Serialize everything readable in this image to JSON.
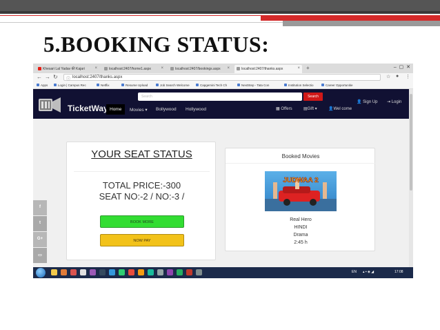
{
  "slide": {
    "title": "5.BOOKING STATUS:"
  },
  "browser": {
    "tabs": [
      {
        "label": "Khesari Lal Yadav की Kajari",
        "icon": "youtube-icon",
        "active": false
      },
      {
        "label": "localhost:2407/home1.aspx",
        "icon": "page-icon",
        "active": false
      },
      {
        "label": "localhost:2407/bookings.aspx",
        "icon": "page-icon",
        "active": false
      },
      {
        "label": "localhost:2407/thanks.aspx",
        "icon": "page-icon",
        "active": true
      }
    ],
    "url": "localhost:2407/thanks.aspx",
    "bookmarks": [
      "Apps",
      "Login | Campus Rec",
      "Netflix",
      "Resume Upload",
      "Job Search Welcome",
      "Capgemini Tech Ch",
      "NextStep - Tata Con",
      "Institution Selectio",
      "Career Opportunitie"
    ]
  },
  "site": {
    "search_placeholder": "Search",
    "search_button": "Search",
    "logo": "TicketWay",
    "nav": [
      "Home",
      "Movies ▾",
      "Bollywood",
      "Hollywood"
    ],
    "signup": "Sign Up",
    "login": "Login",
    "offers": "Offers",
    "gift": "Gift ▾",
    "welcome": "Wel come"
  },
  "seat_status": {
    "title": "YOUR SEAT STATUS",
    "total_price": "TOTAL PRICE:-300",
    "seat_no": "SEAT NO:-2 / NO:-3 /",
    "book_more": "BOOK MORE",
    "now_pay": "NOW PAY"
  },
  "booked_movies": {
    "heading": "Booked Movies",
    "poster_title": "JUDWAA 2",
    "details": [
      "Real Hero",
      "HINDI",
      "Drama",
      "2:45 h"
    ]
  },
  "social": [
    "f",
    "t",
    "G+",
    "▭"
  ],
  "taskbar": {
    "lang": "EN",
    "time": "17:08"
  },
  "colors": {
    "navbar": "#111133",
    "search_button": "#d01818",
    "book_more": "#32dd32",
    "now_pay": "#f2c21a",
    "accent_red": "#d42a2a"
  }
}
